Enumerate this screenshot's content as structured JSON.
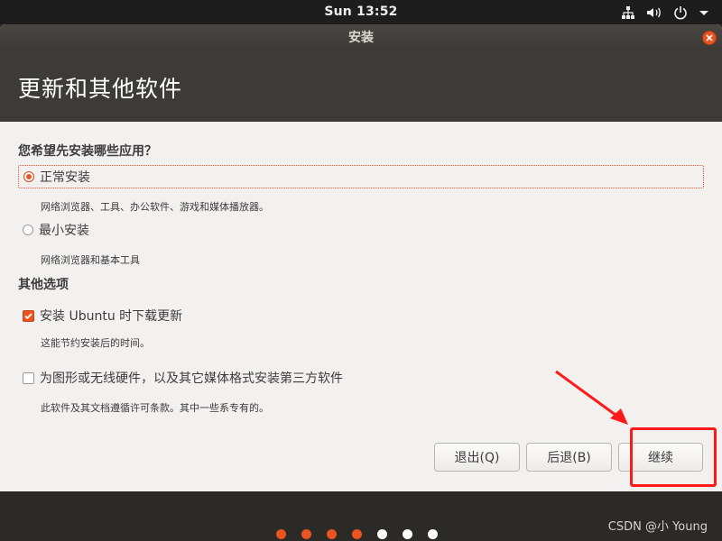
{
  "topbar": {
    "clock": "Sun 13:52",
    "tray_icons": [
      "network-icon",
      "volume-icon",
      "power-icon",
      "dropdown-icon"
    ]
  },
  "window": {
    "title": "安装",
    "header_title": "更新和其他软件"
  },
  "question": "您希望先安装哪些应用？",
  "install_options": [
    {
      "label": "正常安装",
      "description": "网络浏览器、工具、办公软件、游戏和媒体播放器。",
      "selected": true
    },
    {
      "label": "最小安装",
      "description": "网络浏览器和基本工具",
      "selected": false
    }
  ],
  "other_section_title": "其他选项",
  "other_options": [
    {
      "label": "安装 Ubuntu 时下载更新",
      "description": "这能节约安装后的时间。",
      "checked": true
    },
    {
      "label": "为图形或无线硬件，以及其它媒体格式安装第三方软件",
      "description": "此软件及其文档遵循许可条款。其中一些系专有的。",
      "checked": false
    }
  ],
  "buttons": {
    "quit": "退出(Q)",
    "back": "后退(B)",
    "continue": "继续"
  },
  "progress": {
    "total_steps": 7,
    "completed_steps": 4
  },
  "watermark": "CSDN @小 Young",
  "colors": {
    "accent": "#e95420",
    "annotation": "#ff1a1a",
    "header_bg": "#3c3b37",
    "dot_done": "#e95420",
    "dot_pending": "#ffffff"
  }
}
